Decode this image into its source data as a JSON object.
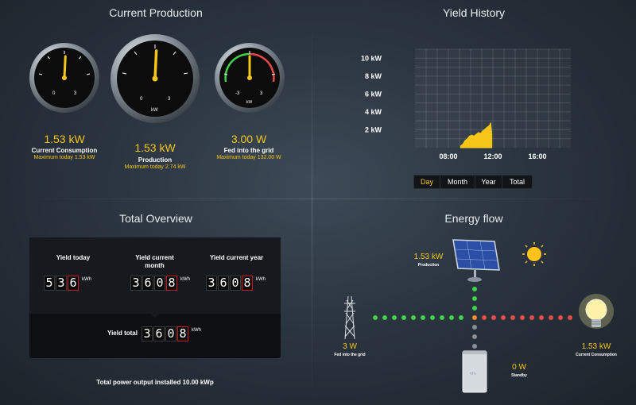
{
  "production": {
    "title": "Current Production",
    "gauges": [
      {
        "value": "1.53 kW",
        "label": "Current Consumption",
        "max": "Maximum today 1.53 kW",
        "tick_min": "0",
        "tick_max": "3",
        "unit": "",
        "level": 0.51
      },
      {
        "value": "1.53 kW",
        "label": "Production",
        "max": "Maximum today 2.74 kW",
        "tick_min": "0",
        "tick_max": "3",
        "unit": "kW",
        "level": 0.51
      },
      {
        "value": "3.00 W",
        "label": "Fed into the grid",
        "max": "Maximum today 132.00 W",
        "tick_min": "-3",
        "tick_max": "3",
        "unit": "kW",
        "level": 0.5
      }
    ]
  },
  "yield_history": {
    "title": "Yield History",
    "tabs": [
      "Day",
      "Month",
      "Year",
      "Total"
    ],
    "active_tab": "Day"
  },
  "chart_data": {
    "type": "area",
    "title": "",
    "xlabel": "",
    "ylabel": "",
    "y_tick_labels": [
      "10 kW",
      "8 kW",
      "6 kW",
      "4 kW",
      "2 kW"
    ],
    "y_ticks": [
      10,
      8,
      6,
      4,
      2
    ],
    "x_tick_labels": [
      "08:00",
      "12:00",
      "16:00"
    ],
    "x_ticks": [
      8,
      12,
      16
    ],
    "xlim": [
      5,
      19
    ],
    "ylim": [
      0,
      11
    ],
    "grid": true,
    "series": [
      {
        "color": "#f5c518",
        "x": [
          9.1,
          9.3,
          9.5,
          9.7,
          9.9,
          10.1,
          10.3,
          10.5,
          10.7,
          10.9,
          11.1,
          11.3,
          11.5,
          11.7,
          11.8,
          11.9
        ],
        "y": [
          0.2,
          0.4,
          0.8,
          1.0,
          1.3,
          1.4,
          1.3,
          1.5,
          1.7,
          1.6,
          1.9,
          2.1,
          2.3,
          2.5,
          2.8,
          1.6
        ]
      }
    ]
  },
  "overview": {
    "title": "Total Overview",
    "today_label": "Yield today",
    "today_digits": [
      "5",
      "3",
      "6"
    ],
    "month_label": "Yield current month",
    "month_digits": [
      "3",
      "6",
      "0",
      "8"
    ],
    "year_label": "Yield current year",
    "year_digits": [
      "3",
      "6",
      "0",
      "8"
    ],
    "total_label": "Yield total",
    "total_digits": [
      "3",
      "6",
      "0",
      "8"
    ],
    "unit": "kWh",
    "installed": "Total power output installed 10.00 kWp"
  },
  "energy_flow": {
    "title": "Energy flow",
    "production_value": "1.53 kW",
    "production_label": "Production",
    "grid_value": "3 W",
    "grid_label": "Fed into the grid",
    "consumption_value": "1.53 kW",
    "consumption_label": "Current Consumption",
    "standby_value": "0 W",
    "standby_label": "Standby"
  },
  "colors": {
    "accent": "#f5c518",
    "flow_green": "#3fd24a",
    "flow_red": "#e84a4a",
    "flow_orange": "#f08a2a",
    "counter_red": "#d01818"
  }
}
